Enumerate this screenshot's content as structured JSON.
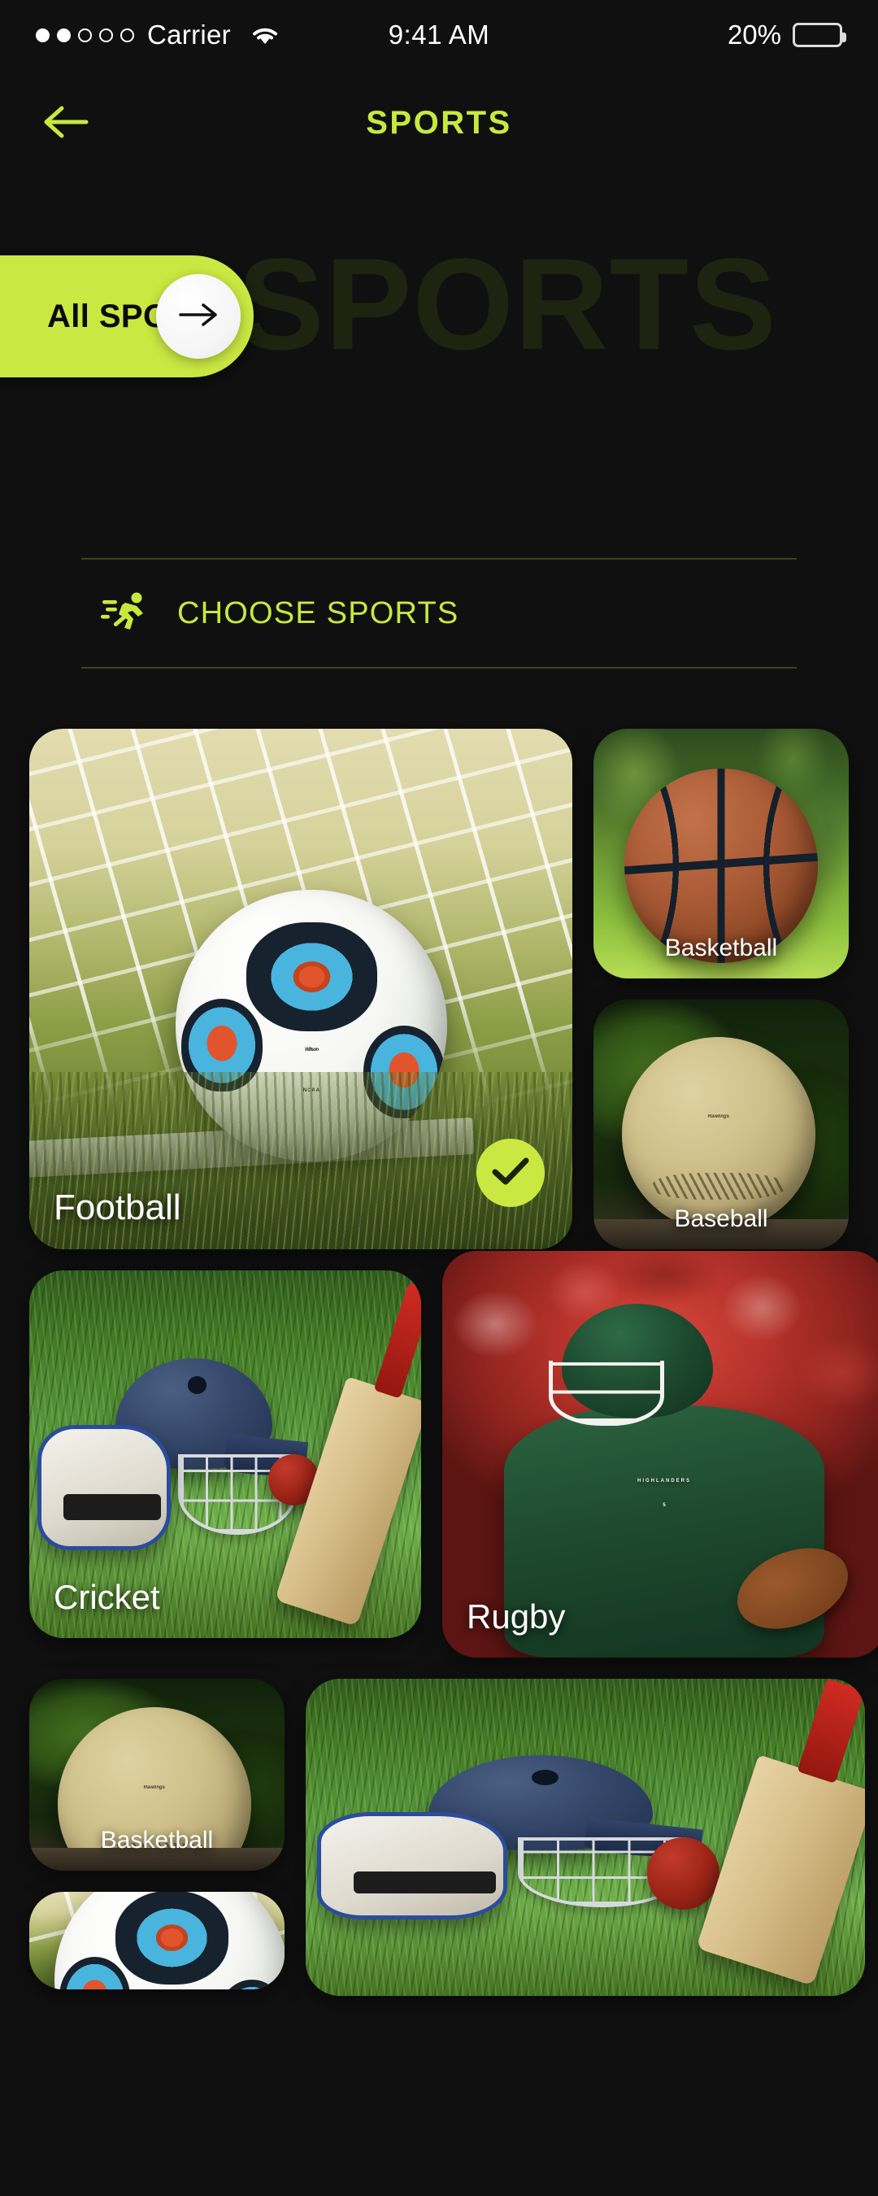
{
  "status_bar": {
    "carrier": "Carrier",
    "signal_dots_filled": 2,
    "signal_dots_total": 5,
    "wifi_icon": "wifi-icon",
    "time": "9:41 AM",
    "battery_percent": "20%",
    "battery_level": 20
  },
  "header": {
    "back_icon": "arrow-left-icon",
    "title": "SPORTS"
  },
  "hero": {
    "watermark": "SPORTS",
    "all_sports_label": "All SPORTS",
    "arrow_icon": "arrow-right-icon"
  },
  "choose_section": {
    "icon": "running-person-icon",
    "label": "CHOOSE SPORTS"
  },
  "colors": {
    "accent_lime": "#cbe742",
    "background": "#101010",
    "watermark": "#1e2410",
    "divider": "#3a441c",
    "label_white": "#ffffff"
  },
  "cards": [
    {
      "id": "football",
      "label": "Football",
      "selected": true,
      "check_icon": "check-icon"
    },
    {
      "id": "basketball",
      "label": "Basketball",
      "selected": false
    },
    {
      "id": "baseball",
      "label": "Baseball",
      "selected": false
    },
    {
      "id": "cricket",
      "label": "Cricket",
      "selected": false
    },
    {
      "id": "rugby",
      "label": "Rugby",
      "selected": false
    },
    {
      "id": "basketball2",
      "label": "Basketball",
      "selected": false
    },
    {
      "id": "cricket2",
      "label": "",
      "selected": false
    },
    {
      "id": "football2",
      "label": "",
      "selected": false
    }
  ]
}
